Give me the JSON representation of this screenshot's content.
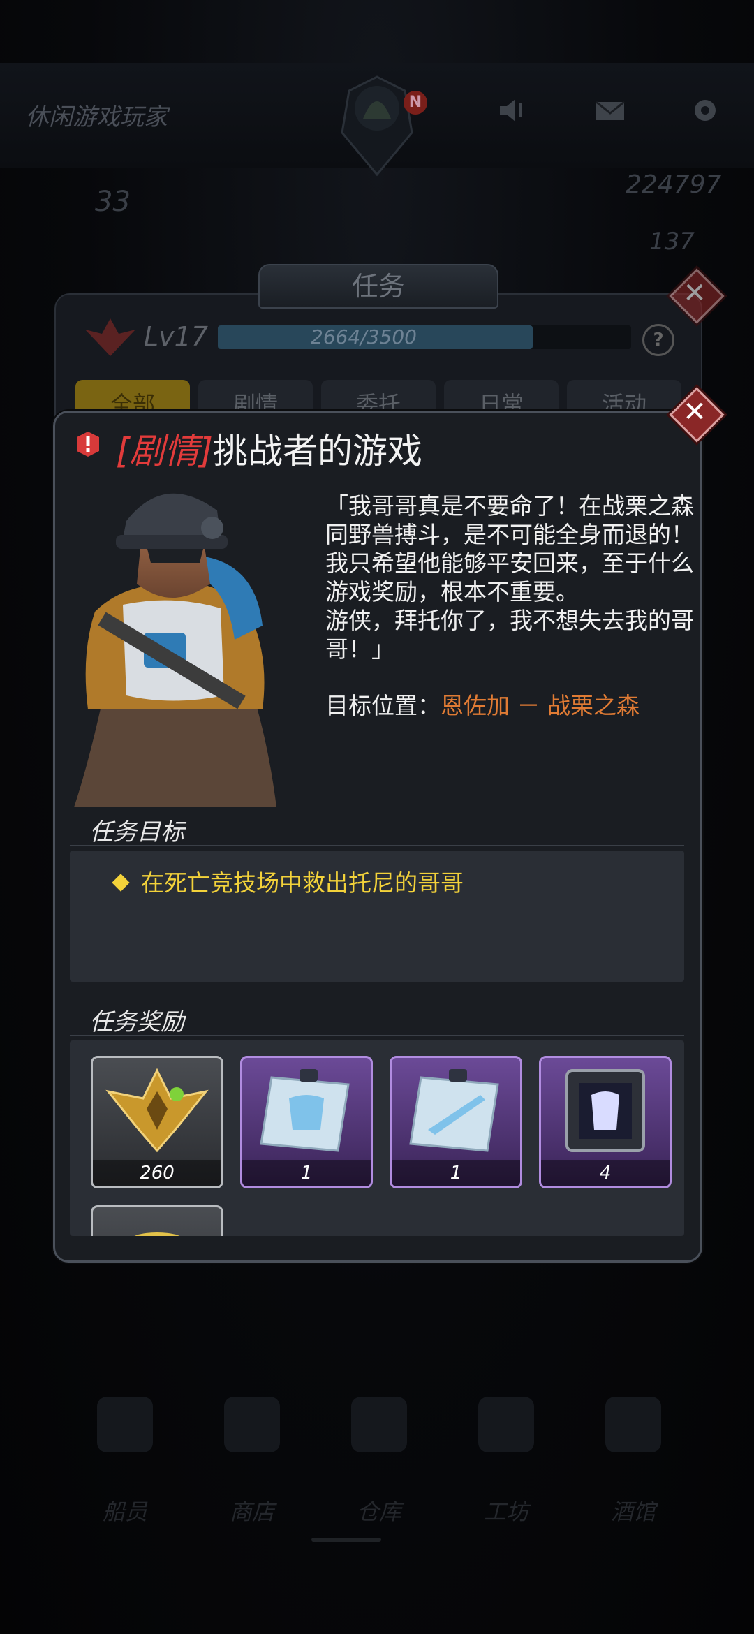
{
  "header": {
    "player_name": "休闲游戏玩家",
    "notification_badge": "N",
    "stat_left": "33",
    "gold": "224797",
    "gems": "137"
  },
  "quest_panel": {
    "title": "任务",
    "level": "Lv17",
    "xp_text": "2664/3500",
    "xp_progress": 0.761,
    "help_icon": "?",
    "tabs": [
      "全部",
      "剧情",
      "委托",
      "日常",
      "活动"
    ]
  },
  "dialog": {
    "tag": "[剧情]",
    "title": "挑战者的游戏",
    "story_lines": [
      "「我哥哥真是不要命了！在战栗之森同野兽搏斗，是不可能全身而退的！",
      "我只希望他能够平安回来，至于什么游戏奖励，根本不重要。",
      "游侠，拜托你了，我不想失去我的哥哥！」"
    ],
    "target_label": "目标位置：",
    "target_location": "恩佐加 － 战栗之森",
    "objective_title": "任务目标",
    "objectives": [
      "在死亡竞技场中救出托尼的哥哥"
    ],
    "reward_title": "任务奖励",
    "rewards": [
      {
        "icon": "rank-emblem-icon",
        "count": "260",
        "rarity": "gray"
      },
      {
        "icon": "armor-blueprint-icon",
        "count": "1",
        "rarity": "purple"
      },
      {
        "icon": "weapon-blueprint-icon",
        "count": "1",
        "rarity": "purple"
      },
      {
        "icon": "armor-crate-icon",
        "count": "4",
        "rarity": "purple"
      },
      {
        "icon": "gold-coin-icon",
        "count": "",
        "rarity": "gray"
      }
    ]
  },
  "bottom_nav": [
    "船员",
    "商店",
    "仓库",
    "工坊",
    "酒馆"
  ],
  "colors": {
    "story_tag": "#e23b3b",
    "location": "#e07b34",
    "objective": "#f3d23a",
    "purple_frame": "#b18ce0"
  }
}
